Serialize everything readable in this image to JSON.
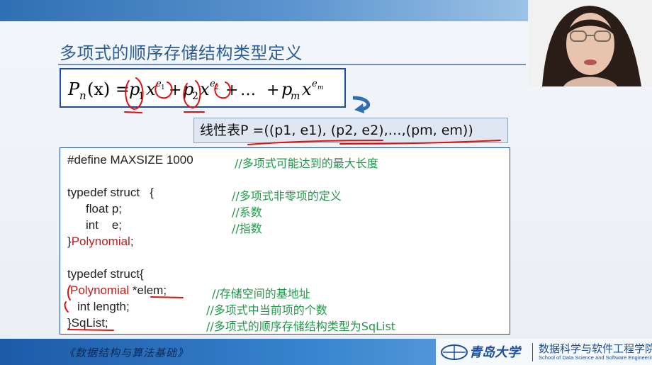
{
  "slide": {
    "title": "多项式的顺序存储结构类型定义",
    "linear_list": "线性表P =((p1, e1), (p2, e2),…,(pm, em))",
    "formula": {
      "lhs_P": "P",
      "lhs_n": "n",
      "lhs_x": "(x) =",
      "p": "p",
      "one": "1",
      "two": "2",
      "m": "m",
      "x": "x",
      "e": "e",
      "plus": "+",
      "ellipsis": "…"
    },
    "code": [
      {
        "code": "#define MAXSIZE 1000",
        "comment": "//多项式可能达到的最大长度"
      },
      {
        "code": "typedef struct   {",
        "comment": "//多项式非零项的定义"
      },
      {
        "code": "float p;",
        "comment": "//系数"
      },
      {
        "code": "int    e;",
        "comment": "//指数"
      },
      {
        "code_red": "Polynomial",
        "code": ";"
      },
      {
        "code": "typedef struct{"
      },
      {
        "code_red": "Polynomial",
        "code": " *elem;",
        "comment": "//存储空间的基地址"
      },
      {
        "code": "int length;",
        "comment": "//多项式中当前项的个数"
      },
      {
        "code": "}SqList;",
        "comment": "//多项式的顺序存储结构类型为SqList"
      }
    ],
    "brace_close": "}"
  },
  "footer": {
    "course": "《数据结构与算法基础》",
    "university": "青岛大学",
    "school_cn": "数据科学与软件工程学院",
    "school_en": "School of Data Science and Software Engineering"
  },
  "colors": {
    "title": "#2d5f97",
    "comment": "#1f9a4a",
    "keyword_red": "#c41a1a",
    "border": "#1d4f9a",
    "annotation": "#e01010"
  }
}
